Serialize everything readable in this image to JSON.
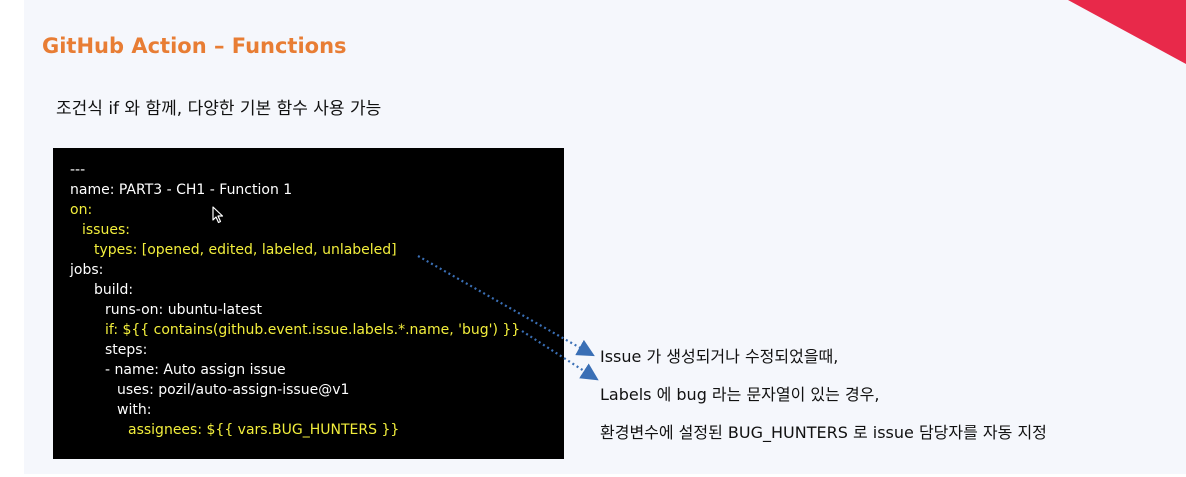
{
  "slide": {
    "title": "GitHub Action – Functions",
    "subtitle": "조건식 if 와 함께, 다양한 기본 함수 사용 가능",
    "accent_color": "#e87d34",
    "corner_color": "#e8294a"
  },
  "code": {
    "lines": [
      {
        "text": "---",
        "indent": 0,
        "color": "white"
      },
      {
        "text": "name: PART3 - CH1 - Function 1",
        "indent": 0,
        "color": "white"
      },
      {
        "text": "on:",
        "indent": 0,
        "color": "yellow"
      },
      {
        "text": "issues:",
        "indent": 1,
        "color": "yellow"
      },
      {
        "text": "types: [opened, edited, labeled, unlabeled]",
        "indent": 2,
        "color": "yellow"
      },
      {
        "text": "jobs:",
        "indent": 0,
        "color": "white"
      },
      {
        "text": "build:",
        "indent": 3,
        "color": "white"
      },
      {
        "text": "runs-on: ubuntu-latest",
        "indent": 4,
        "color": "white"
      },
      {
        "text": "if: ${{ contains(github.event.issue.labels.*.name, 'bug') }}",
        "indent": 4,
        "color": "yellow"
      },
      {
        "text": "steps:",
        "indent": 4,
        "color": "white"
      },
      {
        "text": "- name: Auto assign issue",
        "indent": 4,
        "color": "white"
      },
      {
        "text": "uses: pozil/auto-assign-issue@v1",
        "indent": 5,
        "color": "white"
      },
      {
        "text": "with:",
        "indent": 5,
        "color": "white"
      },
      {
        "text": "assignees: ${{ vars.BUG_HUNTERS }}",
        "indent": 6,
        "color": "yellow"
      }
    ],
    "colors": {
      "white": "#ffffff",
      "yellow": "#f2ee3c"
    }
  },
  "notes": [
    "Issue 가 생성되거나 수정되었을때,",
    "Labels 에 bug 라는 문자열이 있는 경우,",
    "환경변수에 설정된 BUG_HUNTERS 로 issue 담당자를 자동 지정"
  ],
  "arrow_color": "#3a6fb5"
}
